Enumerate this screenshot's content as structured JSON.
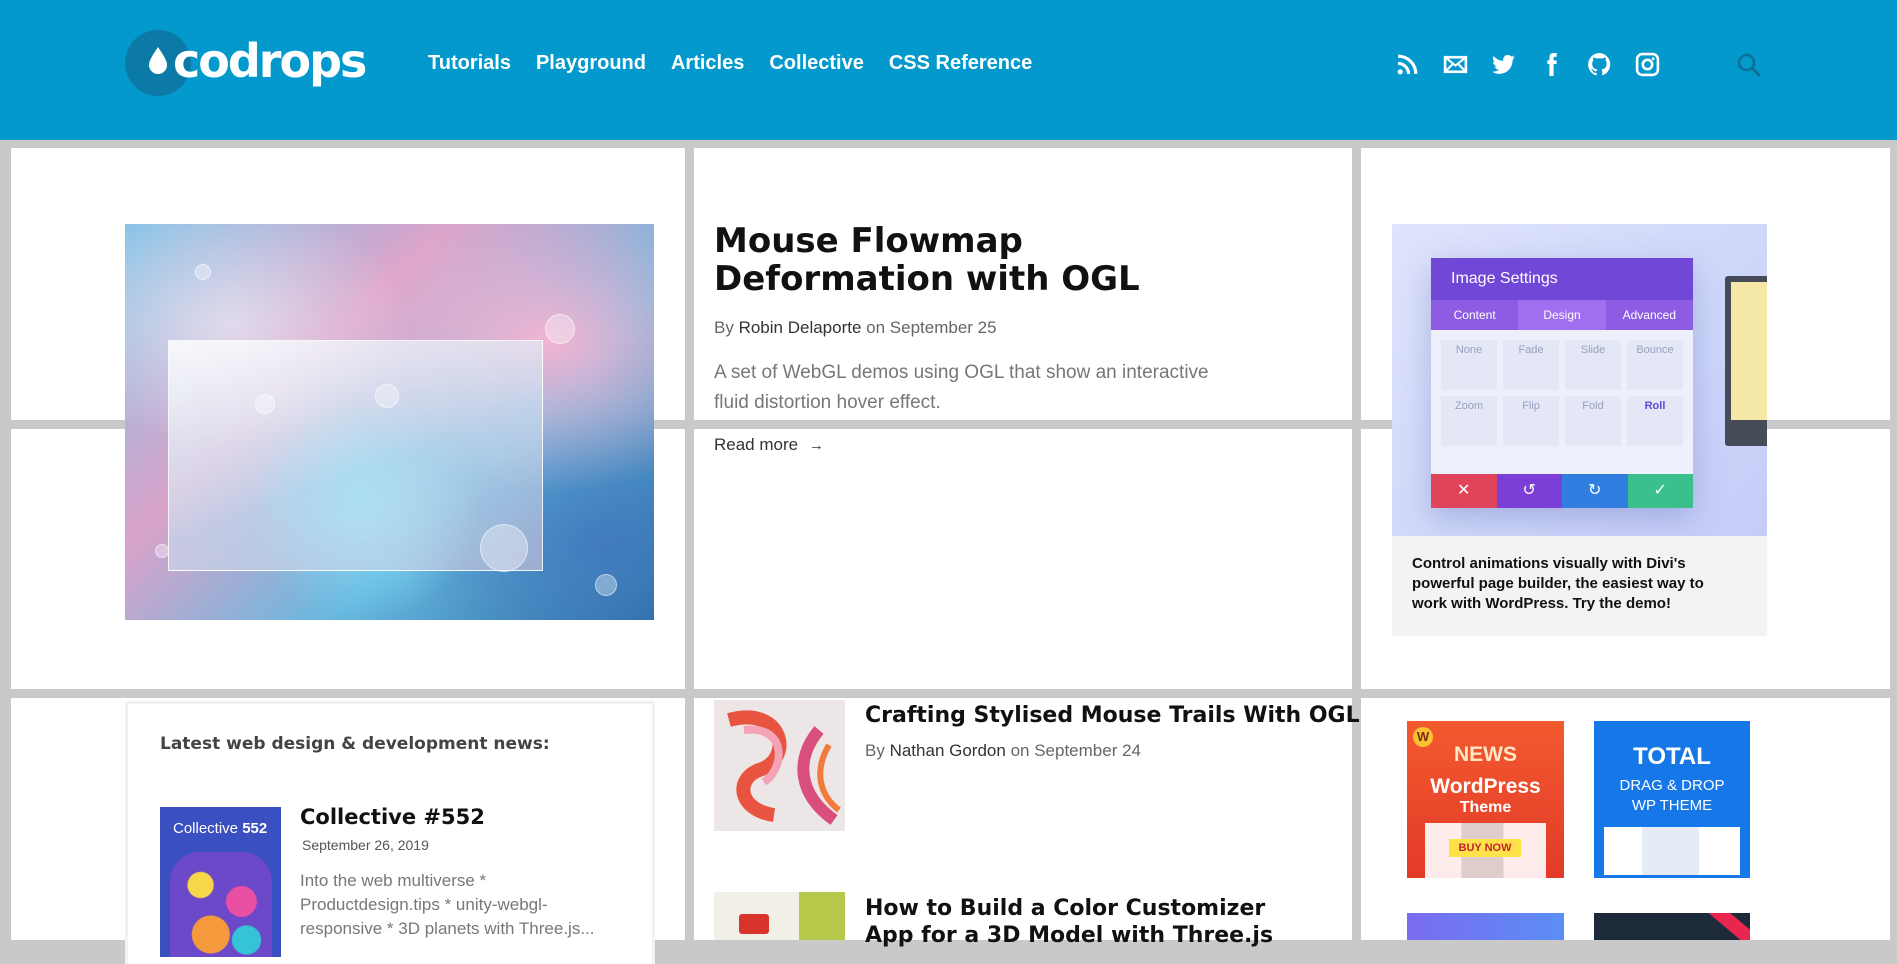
{
  "logo": {
    "text": "codrops"
  },
  "nav": [
    "Tutorials",
    "Playground",
    "Articles",
    "Collective",
    "CSS Reference"
  ],
  "social": [
    "rss-icon",
    "mail-icon",
    "twitter-icon",
    "facebook-icon",
    "github-icon",
    "instagram-icon"
  ],
  "featured": {
    "title": "Mouse Flowmap Deformation with OGL",
    "by": "By",
    "author": "Robin Delaporte",
    "on": "on September 25",
    "excerpt": "A set of WebGL demos using OGL that show an interactive fluid distortion hover effect.",
    "read_more": "Read more",
    "read_more_arrow": "→"
  },
  "ad": {
    "panel_title": "Image Settings",
    "tabs": [
      "Content",
      "Design",
      "Advanced"
    ],
    "cells": [
      "None",
      "Fade",
      "Slide",
      "Bounce",
      "Zoom",
      "Flip",
      "Fold",
      "Roll"
    ],
    "text": "Control animations visually with Divi's powerful page builder, the easiest way to work with WordPress. Try the demo!"
  },
  "news": {
    "heading": "Latest web design & development news:",
    "item": {
      "badge": "Collective",
      "badge_num": "552",
      "title": "Collective #552",
      "date": "September 26, 2019",
      "excerpt": "Into the web multiverse * Productdesign.tips * unity-webgl-responsive * 3D planets with Three.js..."
    }
  },
  "posts": [
    {
      "title": "Crafting Stylised Mouse Trails With OGL",
      "by": "By",
      "author": "Nathan Gordon",
      "on": "on September 24"
    },
    {
      "title": "How to Build a Color Customizer App for a 3D Model with Three.js"
    }
  ],
  "promos": [
    {
      "line1": "NEWS",
      "line2": "WordPress",
      "line3": "Theme",
      "cta": "BUY NOW",
      "color": "#f0522e"
    },
    {
      "line1": "TOTAL",
      "line2": "DRAG & DROP",
      "line3": "WP THEME",
      "color": "#1677e8"
    }
  ],
  "colors": {
    "header": "#0399cd",
    "gutter": "#c9c9c9"
  }
}
